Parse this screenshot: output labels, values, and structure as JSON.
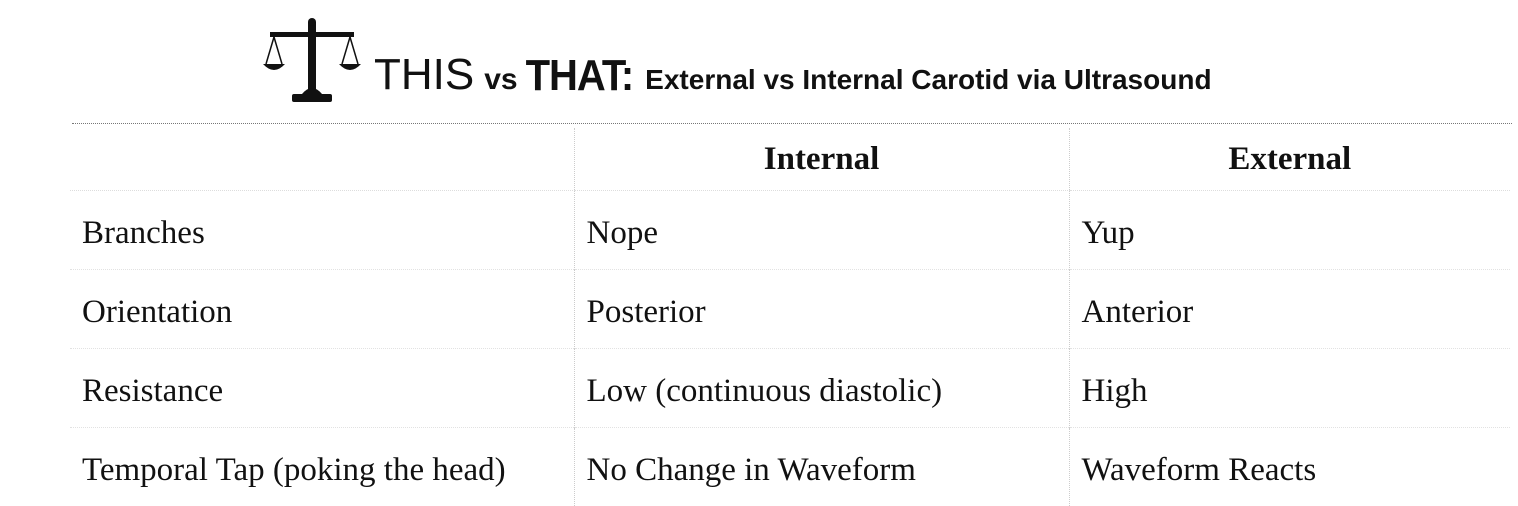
{
  "header": {
    "this_label": "THIS",
    "vs_label": "vs",
    "that_label": "THAT:",
    "subtitle": "External vs Internal Carotid via Ultrasound"
  },
  "icons": {
    "title_icon": "scale-icon"
  },
  "table": {
    "columns": [
      "",
      "Internal",
      "External"
    ],
    "rows": [
      {
        "label": "Branches",
        "internal": "Nope",
        "external": "Yup"
      },
      {
        "label": "Orientation",
        "internal": "Posterior",
        "external": "Anterior"
      },
      {
        "label": "Resistance",
        "internal": "Low (continuous diastolic)",
        "external": "High"
      },
      {
        "label": "Temporal Tap (poking the head)",
        "internal": "No Change in Waveform",
        "external": "Waveform Reacts"
      }
    ]
  }
}
